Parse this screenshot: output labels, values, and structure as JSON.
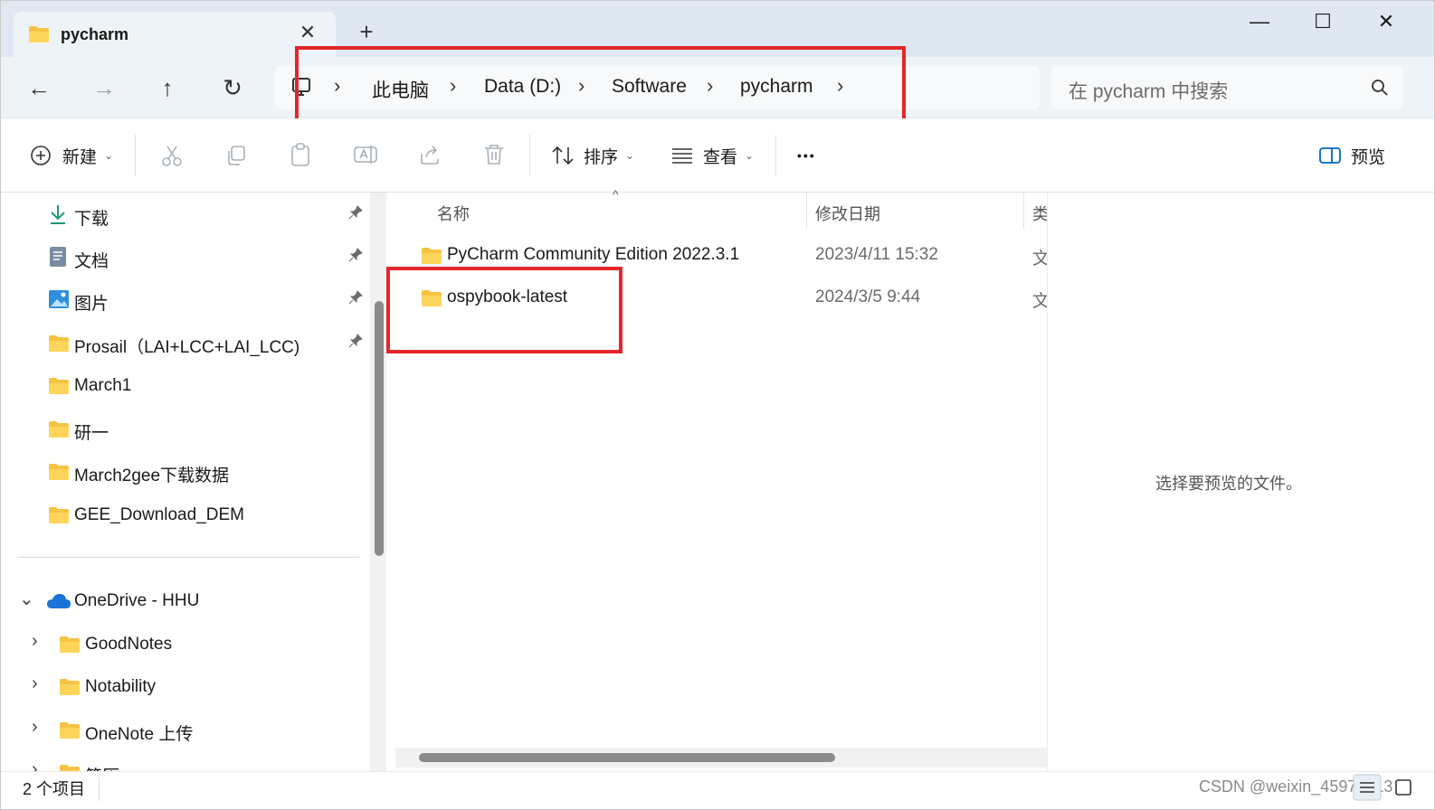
{
  "window": {
    "tab_title": "pycharm",
    "close_glyph": "✕",
    "new_tab_glyph": "+",
    "controls": {
      "minimize": "—",
      "maximize": "☐",
      "close": "✕"
    }
  },
  "nav": {
    "back": "←",
    "forward": "→",
    "up": "↑",
    "refresh": "↻",
    "breadcrumb": [
      "此电脑",
      "Data (D:)",
      "Software",
      "pycharm"
    ],
    "chevron": "›",
    "search_placeholder": "在 pycharm 中搜索"
  },
  "toolbar": {
    "new_label": "新建",
    "sort_label": "排序",
    "view_label": "查看",
    "more_label": "•••",
    "preview_label": "预览",
    "caret": "⌄"
  },
  "sidebar": {
    "quick_access": [
      {
        "label": "下载",
        "icon": "download-icon",
        "pinned": true
      },
      {
        "label": "文档",
        "icon": "document-icon",
        "pinned": true
      },
      {
        "label": "图片",
        "icon": "picture-icon",
        "pinned": true
      },
      {
        "label": "Prosail（LAI+LCC+LAI_LCC)",
        "icon": "folder-icon",
        "pinned": true
      },
      {
        "label": "March1",
        "icon": "folder-icon",
        "pinned": false
      },
      {
        "label": "研一",
        "icon": "folder-icon",
        "pinned": false
      },
      {
        "label": "March2gee下载数据",
        "icon": "folder-icon",
        "pinned": false
      },
      {
        "label": "GEE_Download_DEM",
        "icon": "folder-icon",
        "pinned": false
      }
    ],
    "onedrive": {
      "label": "OneDrive - HHU",
      "expand_glyph": "⌄"
    },
    "onedrive_children": [
      {
        "label": "GoodNotes"
      },
      {
        "label": "Notability"
      },
      {
        "label": "OneNote 上传"
      },
      {
        "label": "简历"
      }
    ],
    "pin_glyph": "📌",
    "collapsed_glyph": "›"
  },
  "file_list": {
    "columns": [
      "名称",
      "修改日期",
      "类"
    ],
    "sort_glyph": "^",
    "rows": [
      {
        "name": "PyCharm Community Edition 2022.3.1",
        "date": "2023/4/11 15:32",
        "type": "文"
      },
      {
        "name": "ospybook-latest",
        "date": "2024/3/5 9:44",
        "type": "文"
      }
    ]
  },
  "preview": {
    "message": "选择要预览的文件。"
  },
  "status": {
    "item_count": "2 个项目",
    "watermark": "CSDN @weixin_45975413"
  },
  "colors": {
    "accent": "#0067c0",
    "highlight_box": "#e5262a",
    "folder": "#f6c343"
  }
}
